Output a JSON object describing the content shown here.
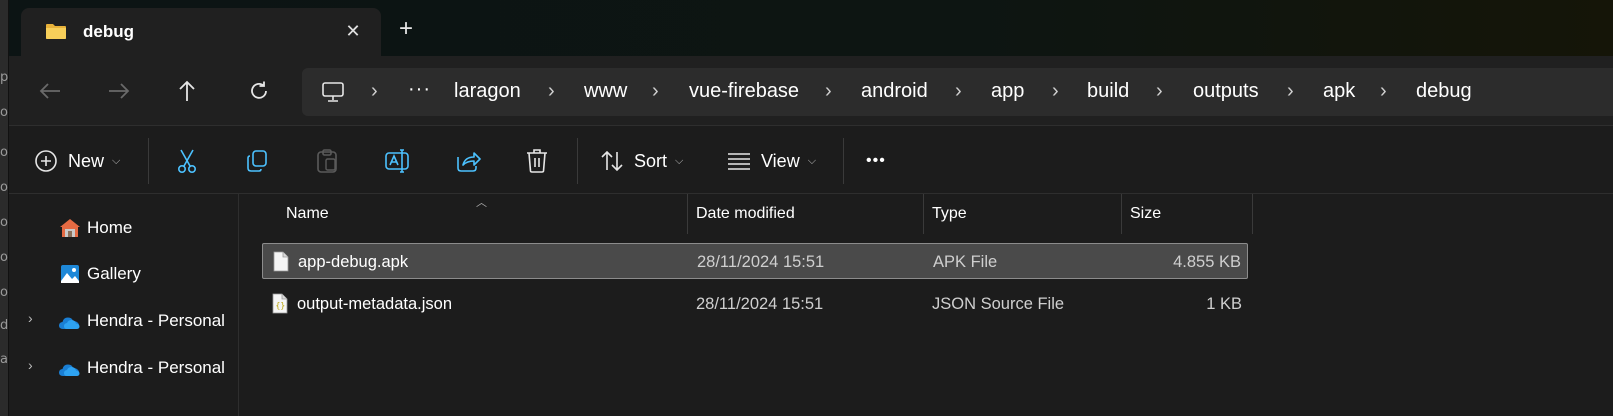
{
  "window": {
    "tab_title": "debug",
    "new_tab_symbol": "+",
    "close_symbol": "✕"
  },
  "nav": {
    "ellipsis": "···",
    "breadcrumbs": [
      "laragon",
      "www",
      "vue-firebase",
      "android",
      "app",
      "build",
      "outputs",
      "apk",
      "debug"
    ]
  },
  "commands": {
    "new_label": "New",
    "sort_label": "Sort",
    "view_label": "View",
    "more_label": "•••"
  },
  "sidebar": {
    "items": [
      {
        "label": "Home",
        "icon": "home-icon"
      },
      {
        "label": "Gallery",
        "icon": "gallery-icon"
      },
      {
        "label": "Hendra - Personal",
        "icon": "onedrive-cloud-icon"
      },
      {
        "label": "Hendra - Personal",
        "icon": "onedrive-cloud-icon"
      }
    ]
  },
  "table": {
    "columns": [
      "Name",
      "Date modified",
      "Type",
      "Size"
    ],
    "rows": [
      {
        "name": "app-debug.apk",
        "date": "28/11/2024 15:51",
        "type": "APK File",
        "size": "4.855 KB",
        "selected": true
      },
      {
        "name": "output-metadata.json",
        "date": "28/11/2024 15:51",
        "type": "JSON Source File",
        "size": "1 KB",
        "selected": false
      }
    ]
  },
  "colors": {
    "accent_blue": "#4cc2ff",
    "folder_yellow": "#f2c54b",
    "selection_bg": "#4a4a4a"
  }
}
